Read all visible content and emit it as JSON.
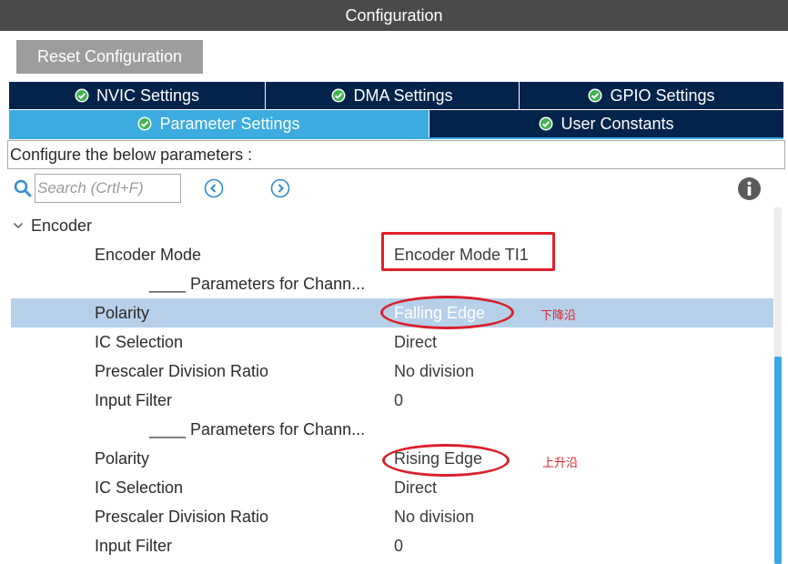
{
  "window": {
    "title": "Configuration"
  },
  "toolbar": {
    "reset_label": "Reset Configuration"
  },
  "tabs": {
    "row1": [
      {
        "label": "NVIC Settings",
        "icon": "check-circle-icon"
      },
      {
        "label": "DMA Settings",
        "icon": "check-circle-icon"
      },
      {
        "label": "GPIO Settings",
        "icon": "check-circle-icon"
      }
    ],
    "row2": [
      {
        "label": "Parameter Settings",
        "icon": "check-circle-icon",
        "active": true
      },
      {
        "label": "User Constants",
        "icon": "check-circle-icon",
        "active": false
      }
    ]
  },
  "description": "Configure the below parameters :",
  "search": {
    "placeholder": "Search (Crtl+F)",
    "value": ""
  },
  "group": {
    "label": "Encoder",
    "expanded": true
  },
  "params": [
    {
      "name": "Encoder Mode",
      "value": "Encoder Mode TI1",
      "type": "param"
    },
    {
      "name": "____ Parameters for Chann...",
      "value": "",
      "type": "section"
    },
    {
      "name": "Polarity",
      "value": "Falling Edge",
      "type": "param",
      "selected": true
    },
    {
      "name": "IC Selection",
      "value": "Direct",
      "type": "param"
    },
    {
      "name": "Prescaler Division Ratio",
      "value": "No division",
      "type": "param"
    },
    {
      "name": "Input Filter",
      "value": "0",
      "type": "param"
    },
    {
      "name": "____ Parameters for Chann...",
      "value": "",
      "type": "section"
    },
    {
      "name": "Polarity",
      "value": "Rising Edge",
      "type": "param"
    },
    {
      "name": "IC Selection",
      "value": "Direct",
      "type": "param"
    },
    {
      "name": "Prescaler Division Ratio",
      "value": "No division",
      "type": "param"
    },
    {
      "name": "Input Filter",
      "value": "0",
      "type": "param"
    }
  ],
  "annotations": {
    "falling_note": "下降沿",
    "rising_note": "上升沿"
  },
  "colors": {
    "titlebar": "#4a4a4a",
    "tab_dark": "#03234b",
    "tab_active": "#3babe0",
    "selected_row": "#b6d0ea",
    "annotation": "#e0202a",
    "check_green": "#3fb34f"
  }
}
